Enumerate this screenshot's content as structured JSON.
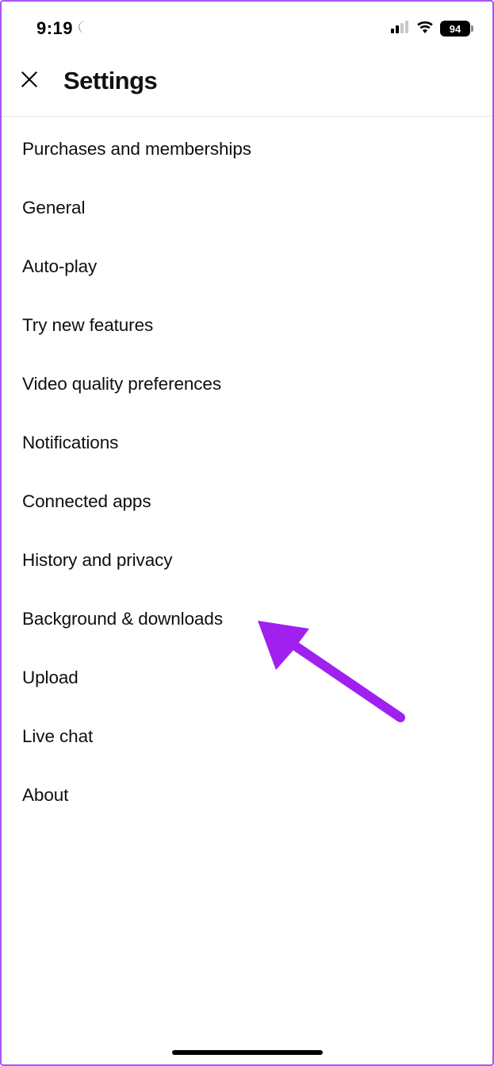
{
  "status": {
    "time": "9:19",
    "battery": "94"
  },
  "header": {
    "title": "Settings"
  },
  "items": [
    {
      "label": "Purchases and memberships"
    },
    {
      "label": "General"
    },
    {
      "label": "Auto-play"
    },
    {
      "label": "Try new features"
    },
    {
      "label": "Video quality preferences"
    },
    {
      "label": "Notifications"
    },
    {
      "label": "Connected apps"
    },
    {
      "label": "History and privacy"
    },
    {
      "label": "Background & downloads"
    },
    {
      "label": "Upload"
    },
    {
      "label": "Live chat"
    },
    {
      "label": "About"
    }
  ]
}
